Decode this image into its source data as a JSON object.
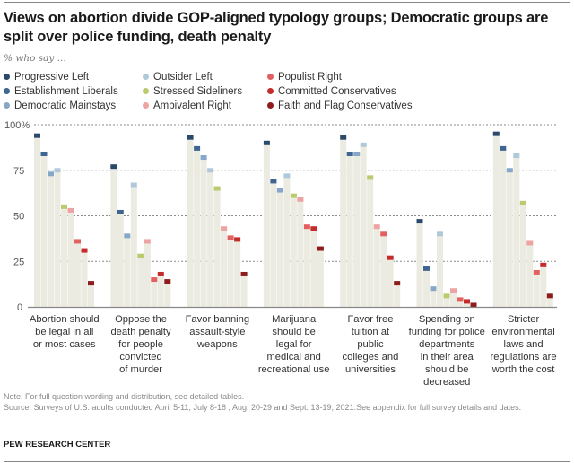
{
  "title": "Views on abortion divide GOP-aligned typology groups; Democratic groups are split over police funding, death penalty",
  "subtitle": "% who say ...",
  "note": "Note: For full question wording and distribution, see detailed tables.",
  "source": "Source: Surveys of U.S. adults conducted April 5-11, July 8-18 , Aug. 20-29 and Sept. 13-19, 2021.See appendix for full survey details and dates.",
  "credit": "PEW RESEARCH CENTER",
  "colors": {
    "bar_background": "#ecebe1",
    "gridline": "#8a8a8a",
    "axis": "#888888"
  },
  "chart_data": {
    "type": "bar",
    "title": "Views on abortion divide GOP-aligned typology groups; Democratic groups are split over police funding, death penalty",
    "subtitle": "% who say ...",
    "xlabel": "",
    "ylabel": "",
    "ylim": [
      0,
      100
    ],
    "yticks": [
      0,
      25,
      50,
      75,
      100
    ],
    "ytick_labels": [
      "0",
      "25",
      "50",
      "75",
      "100%"
    ],
    "grid": true,
    "legend_position": "top-left",
    "categories": [
      "Abortion should be legal in all or most cases",
      "Oppose the death penalty for people convicted of murder",
      "Favor banning assault-style weapons",
      "Marijuana should be legal for medical and recreational use",
      "Favor free tuition at public colleges and universities",
      "Spending on funding for police departments in their area should be decreased",
      "Stricter environmental laws and regulations are worth the cost"
    ],
    "category_label_lines": [
      [
        "Abortion should",
        "be legal in all",
        "or most cases"
      ],
      [
        "Oppose the",
        "death penalty",
        "for people",
        "convicted",
        "of murder"
      ],
      [
        "Favor banning",
        "assault-style",
        "weapons"
      ],
      [
        "Marijuana",
        "should be",
        "legal for",
        "medical and",
        "recreational use"
      ],
      [
        "Favor free",
        "tuition at",
        "public",
        "colleges and",
        "universities"
      ],
      [
        "Spending on",
        "funding for police",
        "departments",
        "in their area",
        "should be",
        "decreased"
      ],
      [
        "Stricter",
        "environmental",
        "laws and",
        "regulations are",
        "worth the cost"
      ]
    ],
    "series": [
      {
        "name": "Progressive Left",
        "color": "#2b4a6b",
        "values": [
          94,
          77,
          93,
          90,
          93,
          47,
          95
        ]
      },
      {
        "name": "Establishment Liberals",
        "color": "#3f6590",
        "values": [
          84,
          52,
          87,
          69,
          84,
          21,
          87
        ]
      },
      {
        "name": "Democratic Mainstays",
        "color": "#86a7c7",
        "values": [
          73,
          39,
          82,
          64,
          84,
          10,
          75
        ]
      },
      {
        "name": "Outsider Left",
        "color": "#b0c9da",
        "values": [
          75,
          67,
          75,
          72,
          89,
          40,
          83
        ]
      },
      {
        "name": "Stressed Sideliners",
        "color": "#b9cb6e",
        "values": [
          55,
          28,
          65,
          61,
          71,
          6,
          57
        ]
      },
      {
        "name": "Ambivalent Right",
        "color": "#eea2a2",
        "values": [
          53,
          36,
          43,
          59,
          44,
          9,
          35
        ]
      },
      {
        "name": "Populist Right",
        "color": "#e2605f",
        "values": [
          36,
          15,
          38,
          44,
          40,
          4,
          19
        ]
      },
      {
        "name": "Committed Conservatives",
        "color": "#c42b2b",
        "values": [
          31,
          18,
          37,
          43,
          27,
          3,
          23
        ]
      },
      {
        "name": "Faith and Flag Conservatives",
        "color": "#8e1c1c",
        "values": [
          13,
          14,
          18,
          32,
          13,
          1,
          6
        ]
      }
    ]
  }
}
